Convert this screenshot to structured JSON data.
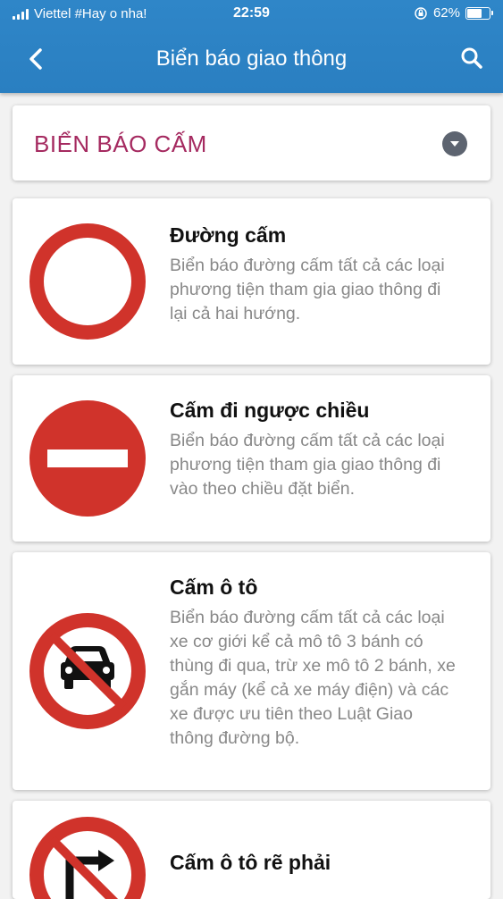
{
  "status_bar": {
    "carrier": "Viettel #Hay o nha!",
    "time": "22:59",
    "battery": "62%"
  },
  "header": {
    "title": "Biển báo giao thông"
  },
  "category": {
    "selected": "BIỂN BÁO CẤM"
  },
  "signs": [
    {
      "name": "Đường cấm",
      "description": "Biển báo đường cấm tất cả các loại phương tiện tham gia giao thông đi lại cả hai hướng."
    },
    {
      "name": "Cấm đi ngược chiều",
      "description": "Biển báo đường cấm tất cả các loại phương tiện tham gia giao thông đi vào theo chiều đặt biển."
    },
    {
      "name": "Cấm ô tô",
      "description": "Biển báo đường cấm tất cả các loại xe cơ giới kể cả mô tô 3 bánh có thùng đi qua, trừ xe mô tô 2 bánh, xe gắn máy (kể cả xe máy điện) và các xe được ưu tiên theo Luật Giao thông đường bộ."
    },
    {
      "name": "Cấm ô tô rẽ phải",
      "description": ""
    }
  ],
  "colors": {
    "header": "#2a7fc1",
    "sign_red": "#d0332b",
    "category_text": "#a52a60"
  }
}
